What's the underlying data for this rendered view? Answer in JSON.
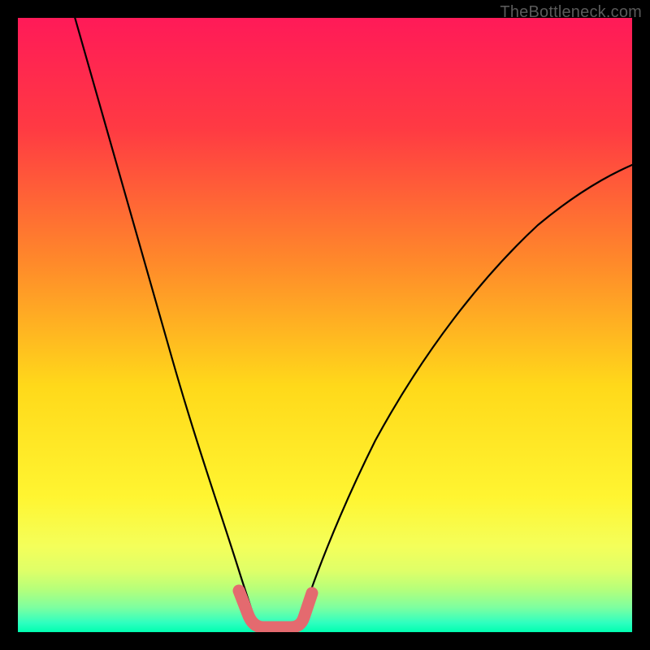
{
  "watermark": "TheBottleneck.com",
  "colors": {
    "black": "#000000",
    "curve": "#000000",
    "highlight": "#e46a6f"
  },
  "chart_data": {
    "type": "line",
    "title": "",
    "xlabel": "",
    "ylabel": "",
    "xlim": [
      0,
      100
    ],
    "ylim": [
      0,
      100
    ],
    "grid": false,
    "legend": false,
    "series": [
      {
        "name": "left-curve",
        "x": [
          9,
          15,
          20,
          25,
          30,
          33,
          36,
          38
        ],
        "y": [
          100,
          77,
          58,
          40,
          23,
          12,
          4,
          0
        ]
      },
      {
        "name": "right-curve",
        "x": [
          45,
          48,
          52,
          58,
          65,
          75,
          85,
          95,
          100
        ],
        "y": [
          0,
          4,
          10,
          20,
          32,
          48,
          61,
          72,
          77
        ]
      },
      {
        "name": "highlight-segment",
        "x": [
          36,
          37,
          38,
          40,
          42,
          44,
          45,
          46,
          47,
          48
        ],
        "y": [
          6,
          2,
          0,
          0,
          0,
          0,
          0,
          1,
          3,
          6
        ]
      }
    ],
    "gradient_stops": [
      {
        "pos": 0.0,
        "color": "#ff1a58"
      },
      {
        "pos": 0.18,
        "color": "#ff3a43"
      },
      {
        "pos": 0.4,
        "color": "#ff8a2a"
      },
      {
        "pos": 0.6,
        "color": "#ffd91a"
      },
      {
        "pos": 0.78,
        "color": "#fff531"
      },
      {
        "pos": 0.86,
        "color": "#f4ff5a"
      },
      {
        "pos": 0.9,
        "color": "#dfff68"
      },
      {
        "pos": 0.93,
        "color": "#b6ff7a"
      },
      {
        "pos": 0.96,
        "color": "#7dffa0"
      },
      {
        "pos": 0.985,
        "color": "#2effc0"
      },
      {
        "pos": 1.0,
        "color": "#00ffb0"
      }
    ]
  }
}
